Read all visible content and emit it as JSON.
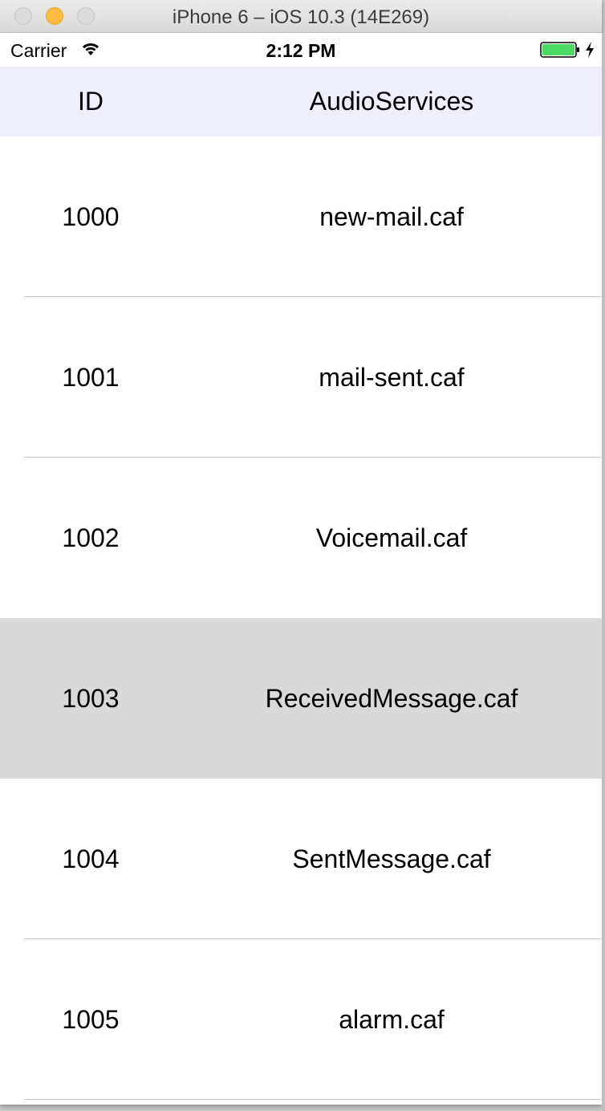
{
  "window": {
    "title": "iPhone 6 – iOS 10.3 (14E269)"
  },
  "status_bar": {
    "carrier": "Carrier",
    "time": "2:12 PM",
    "icons": [
      "wifi-icon",
      "battery-icon",
      "charging-bolt-icon"
    ],
    "battery_color": "#4cd964"
  },
  "table": {
    "header": {
      "id_label": "ID",
      "name_label": "AudioServices",
      "background": "#efeffb"
    },
    "rows": [
      {
        "id": "1000",
        "name": "new-mail.caf",
        "selected": false
      },
      {
        "id": "1001",
        "name": "mail-sent.caf",
        "selected": false
      },
      {
        "id": "1002",
        "name": "Voicemail.caf",
        "selected": false
      },
      {
        "id": "1003",
        "name": "ReceivedMessage.caf",
        "selected": true
      },
      {
        "id": "1004",
        "name": "SentMessage.caf",
        "selected": false
      },
      {
        "id": "1005",
        "name": "alarm.caf",
        "selected": false
      }
    ],
    "selected_row_color": "#d9d9d9"
  }
}
